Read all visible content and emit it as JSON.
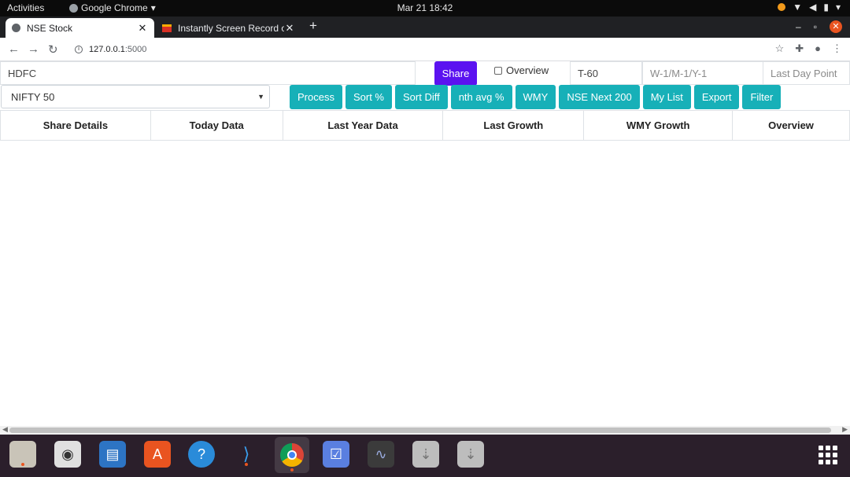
{
  "os": {
    "activities": "Activities",
    "app_name": "Google Chrome",
    "datetime": "Mar 21  18:42"
  },
  "browser": {
    "tabs": [
      {
        "label": "NSE Stock"
      },
      {
        "label": "Instantly Screen Record o"
      }
    ],
    "url_host": "127.0.0.1",
    "url_port": ":5000"
  },
  "form": {
    "symbol_value": "HDFC",
    "share_label": "Share",
    "overview_checkbox_label": "Overview",
    "t_value": "T-60",
    "wmy_placeholder": "W-1/M-1/Y-1",
    "last_day_placeholder": "Last Day Point",
    "index_select": "NIFTY 50"
  },
  "buttons": [
    "Process",
    "Sort %",
    "Sort Diff",
    "nth avg %",
    "WMY",
    "NSE Next 200",
    "My List",
    "Export",
    "Filter"
  ],
  "table": {
    "headers": [
      "Share Details",
      "Today Data",
      "Last Year Data",
      "Last Growth",
      "WMY Growth",
      "Overview"
    ]
  },
  "colors": {
    "share_button": "#5b12f0",
    "action_button": "#17b0b8",
    "dock_bg": "#2b1f2b"
  }
}
